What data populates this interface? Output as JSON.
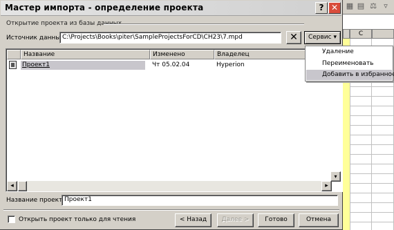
{
  "background": {
    "column_header": "C",
    "toolbar_icons": [
      "grid-icon",
      "table-icon",
      "scales-icon",
      "funnel-icon"
    ]
  },
  "dialog": {
    "title": "Мастер импорта - определение проекта",
    "help_glyph": "?",
    "close_glyph": "✕",
    "section_label": "Открытие проекта из базы данных",
    "source_label": "Источник данных:",
    "source_value": "C:\\Projects\\Books\\piter\\SampleProjectsForCD\\CH23\\7.mpd",
    "clear_glyph": "✕",
    "service_label": "Сервис",
    "service_arrow": "▾",
    "list": {
      "columns": [
        "Название",
        "Изменено",
        "Владелец"
      ],
      "rows": [
        {
          "name": "Проект1",
          "modified": "Чт 05.02.04",
          "owner": "Hyperion"
        }
      ]
    },
    "project_name_label": "Название проекта:",
    "project_name_value": "Проект1",
    "readonly_checkbox_label": "Открыть проект только для чтения",
    "readonly_checked": false,
    "buttons": {
      "back": "< Назад",
      "next": "Далее >",
      "finish": "Готово",
      "cancel": "Отмена"
    }
  },
  "menu": {
    "items": [
      "Удаление",
      "Переименовать",
      "Добавить в избранное"
    ],
    "selected_index": 2
  },
  "colors": {
    "selection": "#c8c6cc",
    "close_button": "#d94c3b",
    "sheet_highlight": "#ffff99"
  }
}
